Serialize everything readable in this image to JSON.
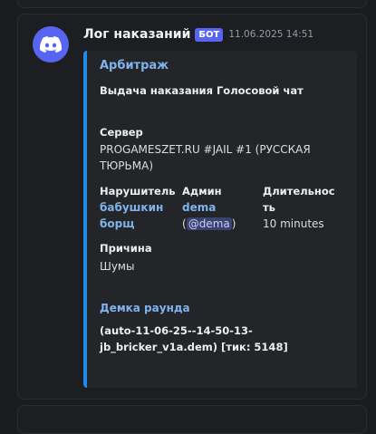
{
  "message": {
    "author": "Лог наказаний",
    "bot_tag": "БОТ",
    "timestamp": "11.06.2025 14:51",
    "avatar_icon": "discord-logo-icon"
  },
  "embed": {
    "accent_color": "#1e8ce8",
    "title": "Арбитраж",
    "description": "Выдача наказания Голосовой чат",
    "server": {
      "name": "Сервер",
      "value_line1": "PROGAMESZET.RU #JAIL #1 (РУССКАЯ",
      "value_line2": "ТЮРЬМА)"
    },
    "violator": {
      "name": "Нарушитель",
      "value_line1": "бабушкин",
      "value_line2": "борщ"
    },
    "admin": {
      "name": "Админ",
      "value": "dema",
      "paren_open": "(",
      "mention": "@dema",
      "paren_close": ")"
    },
    "duration": {
      "name_line1": "Длительнос",
      "name_line2": "ть",
      "value": "10 minutes"
    },
    "reason": {
      "name": "Причина",
      "value": "Шумы"
    },
    "demo": {
      "link": "Демка раунда",
      "line1": "(auto-11-06-25--14-50-13-",
      "line2": "jb_bricker_v1a.dem) [тик: 5148]"
    }
  }
}
